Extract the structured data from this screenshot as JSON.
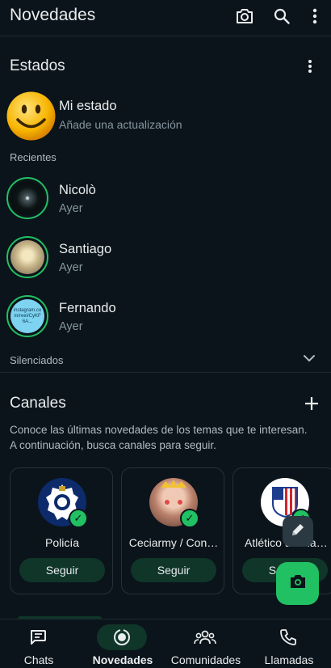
{
  "header": {
    "title": "Novedades",
    "icons": [
      "camera-icon",
      "search-icon",
      "more-vert-icon"
    ]
  },
  "status": {
    "title": "Estados",
    "my_status": {
      "name": "Mi estado",
      "subtitle": "Añade una actualización"
    },
    "recent_label": "Recientes",
    "items": [
      {
        "name": "Nicolò",
        "time": "Ayer"
      },
      {
        "name": "Santiago",
        "time": "Ayer"
      },
      {
        "name": "Fernando",
        "time": "Ayer"
      }
    ],
    "muted_label": "Silenciados"
  },
  "channels": {
    "title": "Canales",
    "description_line1": "Conoce las últimas novedades de los temas que te interesan.",
    "description_line2": "A continuación, busca canales para seguir.",
    "cards": [
      {
        "name": "Policía",
        "button": "Seguir"
      },
      {
        "name": "Ceciarmy / Con…",
        "button": "Seguir"
      },
      {
        "name": "Atlético de Ma…",
        "button": "Seguir"
      }
    ]
  },
  "thumb_text": {
    "fernando": "instagram.com/reel/CyKF6A..."
  },
  "bottom_nav": {
    "items": [
      {
        "label": "Chats",
        "icon": "chats-icon"
      },
      {
        "label": "Novedades",
        "icon": "updates-icon",
        "active": true
      },
      {
        "label": "Comunidades",
        "icon": "communities-icon"
      },
      {
        "label": "Llamadas",
        "icon": "calls-icon"
      }
    ]
  },
  "colors": {
    "background": "#0b141a",
    "accent": "#21c063",
    "active_pill": "#103529",
    "text_secondary": "#8696a0"
  }
}
